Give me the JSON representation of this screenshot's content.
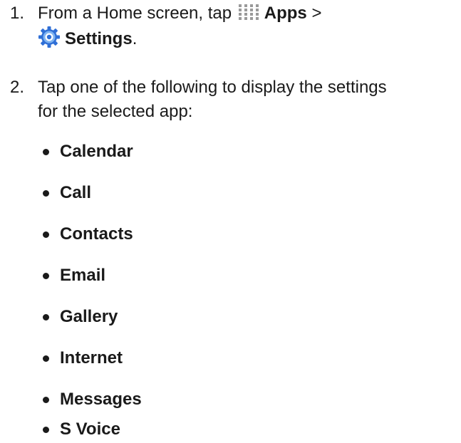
{
  "steps": [
    {
      "number": "1.",
      "prefix": "From a Home screen, tap",
      "apps_label": "Apps",
      "separator": ">",
      "settings_label": "Settings",
      "suffix": "."
    },
    {
      "number": "2.",
      "line1": "Tap one of the following to display the settings",
      "line2": "for the selected app:"
    }
  ],
  "apps": [
    {
      "label": "Calendar"
    },
    {
      "label": "Call"
    },
    {
      "label": "Contacts"
    },
    {
      "label": "Email"
    },
    {
      "label": "Gallery"
    },
    {
      "label": "Internet"
    },
    {
      "label": "Messages"
    },
    {
      "label": "S Voice"
    }
  ],
  "icons": {
    "apps": "apps-grid-icon",
    "settings": "settings-gear-icon"
  },
  "colors": {
    "text": "#1a1a1a",
    "apps_icon": "#9a9a9a",
    "settings_icon_outer": "#2f6fd6",
    "settings_icon_inner": "#7fb4f2"
  }
}
